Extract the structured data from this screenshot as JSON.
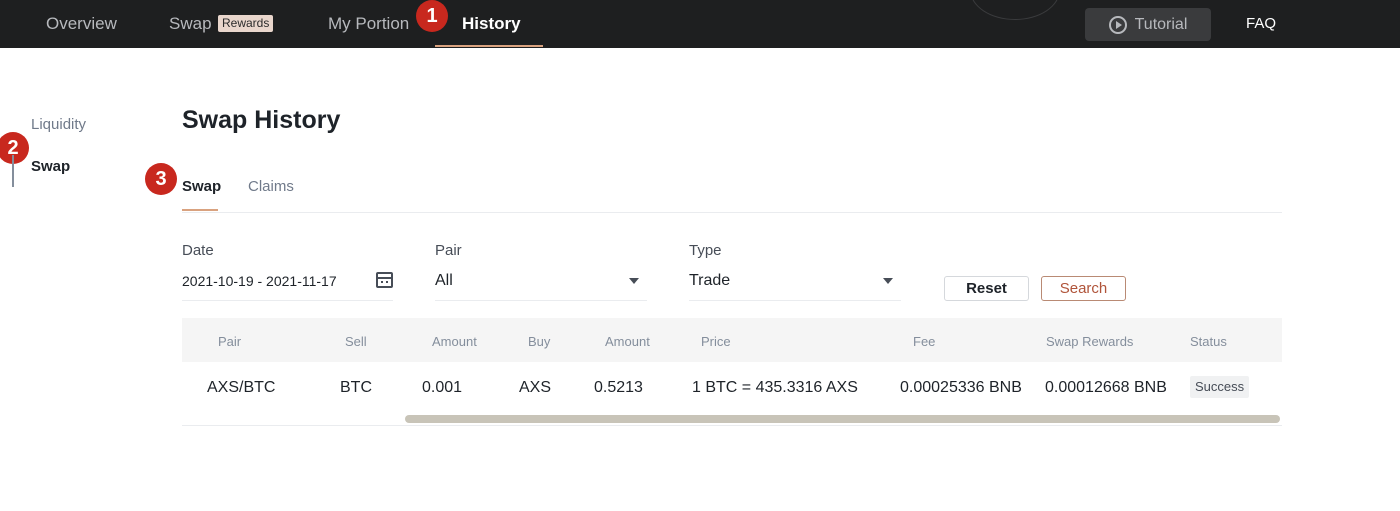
{
  "topnav": {
    "items": [
      {
        "label": "Overview"
      },
      {
        "label": "Swap",
        "badge": "Rewards"
      },
      {
        "label": "My Portion"
      },
      {
        "label": "History"
      }
    ],
    "tutorial_label": "Tutorial",
    "faq_label": "FAQ"
  },
  "markers": [
    "1",
    "2",
    "3"
  ],
  "sidebar": {
    "items": [
      {
        "label": "Liquidity"
      },
      {
        "label": "Swap"
      }
    ]
  },
  "main": {
    "title": "Swap History",
    "tabs": [
      {
        "label": "Swap"
      },
      {
        "label": "Claims"
      }
    ],
    "filters": {
      "date": {
        "label": "Date",
        "value": "2021-10-19 - 2021-11-17"
      },
      "pair": {
        "label": "Pair",
        "value": "All"
      },
      "type": {
        "label": "Type",
        "value": "Trade"
      }
    },
    "reset_label": "Reset",
    "search_label": "Search",
    "table": {
      "columns": [
        "Pair",
        "Sell",
        "Amount",
        "Buy",
        "Amount",
        "Price",
        "Fee",
        "Swap Rewards",
        "Status"
      ],
      "rows": [
        [
          "AXS/BTC",
          "BTC",
          "0.001",
          "AXS",
          "0.5213",
          "1 BTC = 435.3316 AXS",
          "0.00025336 BNB",
          "0.00012668 BNB",
          "Success"
        ]
      ]
    }
  },
  "colors": {
    "topbar_bg": "#1e1f20",
    "accent": "#d9a27f",
    "marker": "#c8281e",
    "search_text": "#b0543a"
  }
}
